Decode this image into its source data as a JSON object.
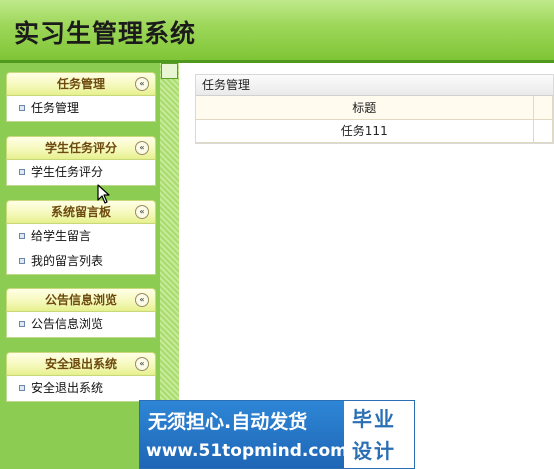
{
  "app": {
    "title": "实习生管理系统"
  },
  "sidebar": {
    "groups": [
      {
        "title": "任务管理",
        "items": [
          "任务管理"
        ]
      },
      {
        "title": "学生任务评分",
        "items": [
          "学生任务评分"
        ]
      },
      {
        "title": "系统留言板",
        "items": [
          "给学生留言",
          "我的留言列表"
        ]
      },
      {
        "title": "公告信息浏览",
        "items": [
          "公告信息浏览"
        ]
      },
      {
        "title": "安全退出系统",
        "items": [
          "安全退出系统"
        ]
      }
    ],
    "collapse_glyph": "«"
  },
  "main": {
    "panel_title": "任务管理",
    "table": {
      "columns": [
        "标题",
        ""
      ],
      "rows": [
        [
          "任务111",
          ""
        ]
      ]
    }
  },
  "ad": {
    "line1": "无须担心.自动发货",
    "line2": "www.51topmind.com",
    "right1": "毕业",
    "right2": "设计"
  },
  "colors": {
    "header": "#9fd85c",
    "sidebar": "#8dcc52",
    "accent": "#2a6fb4"
  }
}
